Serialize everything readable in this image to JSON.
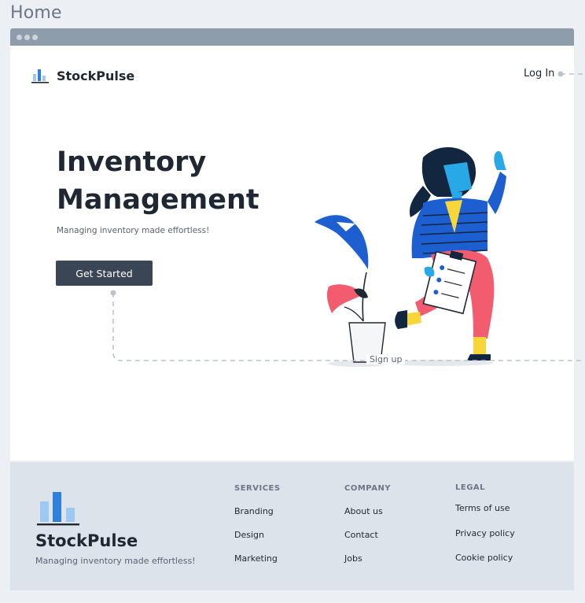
{
  "page_label": "Home",
  "header": {
    "brand": "StockPulse",
    "login": "Log In"
  },
  "hero": {
    "title_line1": "Inventory",
    "title_line2": "Management",
    "subtitle": "Managing inventory made effortless!",
    "cta": "Get Started"
  },
  "flow": {
    "signup_label": "Sign up"
  },
  "footer": {
    "brand": "StockPulse",
    "tagline": "Managing inventory made effortless!",
    "columns": {
      "services": {
        "title": "SERVICES",
        "links": [
          "Branding",
          "Design",
          "Marketing"
        ]
      },
      "company": {
        "title": "COMPANY",
        "links": [
          "About us",
          "Contact",
          "Jobs"
        ]
      },
      "legal": {
        "title": "LEGAL",
        "links": [
          "Terms of use",
          "Privacy policy",
          "Cookie policy"
        ]
      }
    }
  },
  "colors": {
    "primary_dark": "#3a4556",
    "brand_blue": "#2f7fdc",
    "brand_light_blue": "#9cc8f2",
    "illustration_pink": "#f25c6e",
    "illustration_blue": "#1d5fd1",
    "illustration_cyan": "#29a8e8",
    "footer_bg": "#dde3ea"
  },
  "icons": {
    "logo": "bar-chart-icon",
    "window_dots": "window-dots-icon"
  }
}
